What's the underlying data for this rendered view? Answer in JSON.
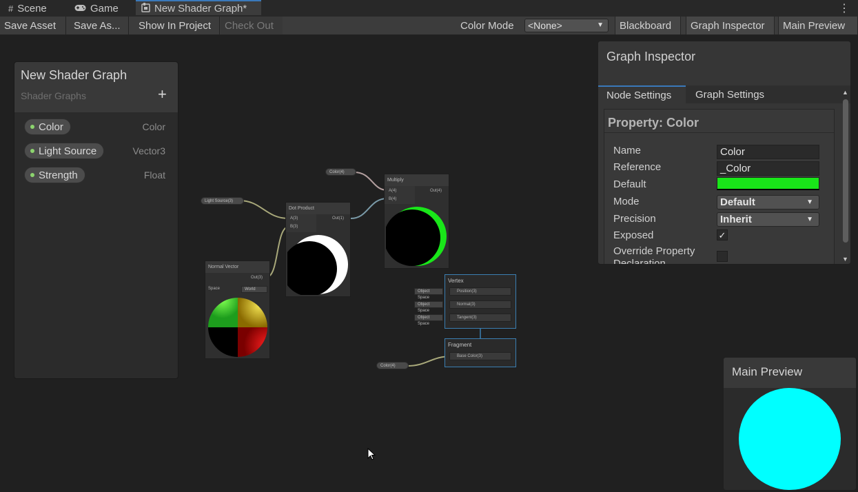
{
  "tabs": [
    {
      "label": "Scene",
      "icon": "grid-icon"
    },
    {
      "label": "Game",
      "icon": "gamepad-icon"
    },
    {
      "label": "New Shader Graph*",
      "icon": "shader-graph-icon"
    }
  ],
  "toolbar": {
    "save_asset": "Save Asset",
    "save_as": "Save As...",
    "show_in_project": "Show In Project",
    "check_out": "Check Out",
    "color_mode_label": "Color Mode",
    "color_mode_value": "<None>",
    "blackboard": "Blackboard",
    "graph_inspector": "Graph Inspector",
    "main_preview": "Main Preview"
  },
  "blackboard": {
    "title": "New Shader Graph",
    "subtitle": "Shader Graphs",
    "add_symbol": "+",
    "properties": [
      {
        "name": "Color",
        "type": "Color"
      },
      {
        "name": "Light Source",
        "type": "Vector3"
      },
      {
        "name": "Strength",
        "type": "Float"
      }
    ]
  },
  "graph": {
    "color_pill_top": "Color(4)",
    "light_source_pill": "Light Source(3)",
    "dot_product": {
      "title": "Dot Product",
      "in_a": "A(3)",
      "in_b": "B(3)",
      "out": "Out(1)"
    },
    "multiply": {
      "title": "Multiply",
      "in_a": "A(4)",
      "in_b": "B(4)",
      "out": "Out(4)"
    },
    "normal_vector": {
      "title": "Normal Vector",
      "out": "Out(3)",
      "space_label": "Space",
      "space_value": "World"
    },
    "vertex": {
      "title": "Vertex",
      "slots": [
        "Position(3)",
        "Normal(3)",
        "Tangent(3)"
      ],
      "space_pills": [
        "Object Space",
        "Object Space",
        "Object Space"
      ]
    },
    "fragment": {
      "title": "Fragment",
      "slots": [
        "Base Color(3)"
      ]
    },
    "color_pill_bottom": "Color(4)"
  },
  "inspector": {
    "title": "Graph Inspector",
    "tabs": [
      "Node Settings",
      "Graph Settings"
    ],
    "property_title": "Property: Color",
    "name_label": "Name",
    "name_value": "Color",
    "reference_label": "Reference",
    "reference_value": "_Color",
    "default_label": "Default",
    "default_color": "#19e619",
    "mode_label": "Mode",
    "mode_value": "Default",
    "precision_label": "Precision",
    "precision_value": "Inherit",
    "exposed_label": "Exposed",
    "exposed_checked": true,
    "check_mark": "✓",
    "override_label": "Override Property Declaration",
    "override_checked": false
  },
  "main_preview": {
    "title": "Main Preview",
    "color": "#00ffff"
  },
  "colors": {
    "accent": "#3a79bb",
    "green_dot": "#8cd46e",
    "preview_cyan": "#00ffff"
  }
}
